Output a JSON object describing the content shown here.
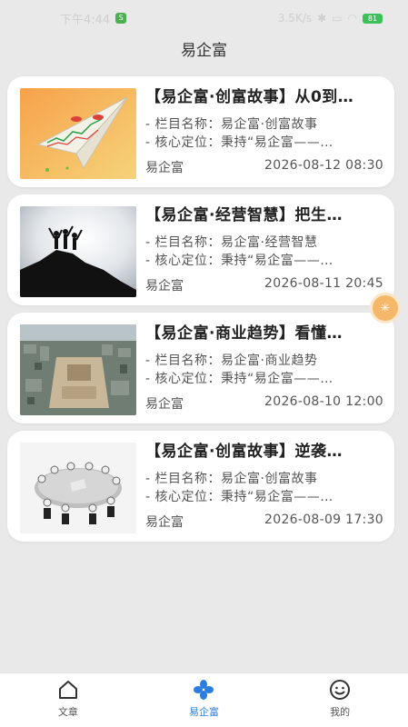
{
  "status_bar": {
    "time": "下午4:44",
    "notif": "S",
    "speed": "3.5K/s",
    "battery": "81"
  },
  "header": {
    "title": "易企富"
  },
  "articles": [
    {
      "title": "【易企富·创富故事】从0到…",
      "meta1": "- 栏目名称：易企富·创富故事",
      "meta2": "- 核心定位：秉持“易企富——…",
      "source": "易企富",
      "date": "2026-08-12 08:30",
      "thumb_icon": "paper-airplane-chart-image"
    },
    {
      "title": "【易企富·经营智慧】把生…",
      "meta1": "- 栏目名称：易企富·经营智慧",
      "meta2": "- 核心定位：秉持“易企富——…",
      "source": "易企富",
      "date": "2026-08-11 20:45",
      "thumb_icon": "mountain-silhouette-image"
    },
    {
      "title": "【易企富·商业趋势】看懂…",
      "meta1": "- 栏目名称：易企富·商业趋势",
      "meta2": "- 核心定位：秉持“易企富——…",
      "source": "易企富",
      "date": "2026-08-10 12:00",
      "thumb_icon": "city-aerial-image"
    },
    {
      "title": "【易企富·创富故事】逆袭…",
      "meta1": "- 栏目名称：易企富·创富故事",
      "meta2": "- 核心定位：秉持“易企富——…",
      "source": "易企富",
      "date": "2026-08-09 17:30",
      "thumb_icon": "meeting-table-image"
    }
  ],
  "floating_button": {
    "icon": "accessibility-icon"
  },
  "tabbar": {
    "tabs": [
      {
        "label": "文章",
        "icon": "home-icon",
        "active": false
      },
      {
        "label": "易企富",
        "icon": "clover-icon",
        "active": true
      },
      {
        "label": "我的",
        "icon": "smiley-icon",
        "active": false
      }
    ],
    "active_color": "#2b7de0"
  }
}
